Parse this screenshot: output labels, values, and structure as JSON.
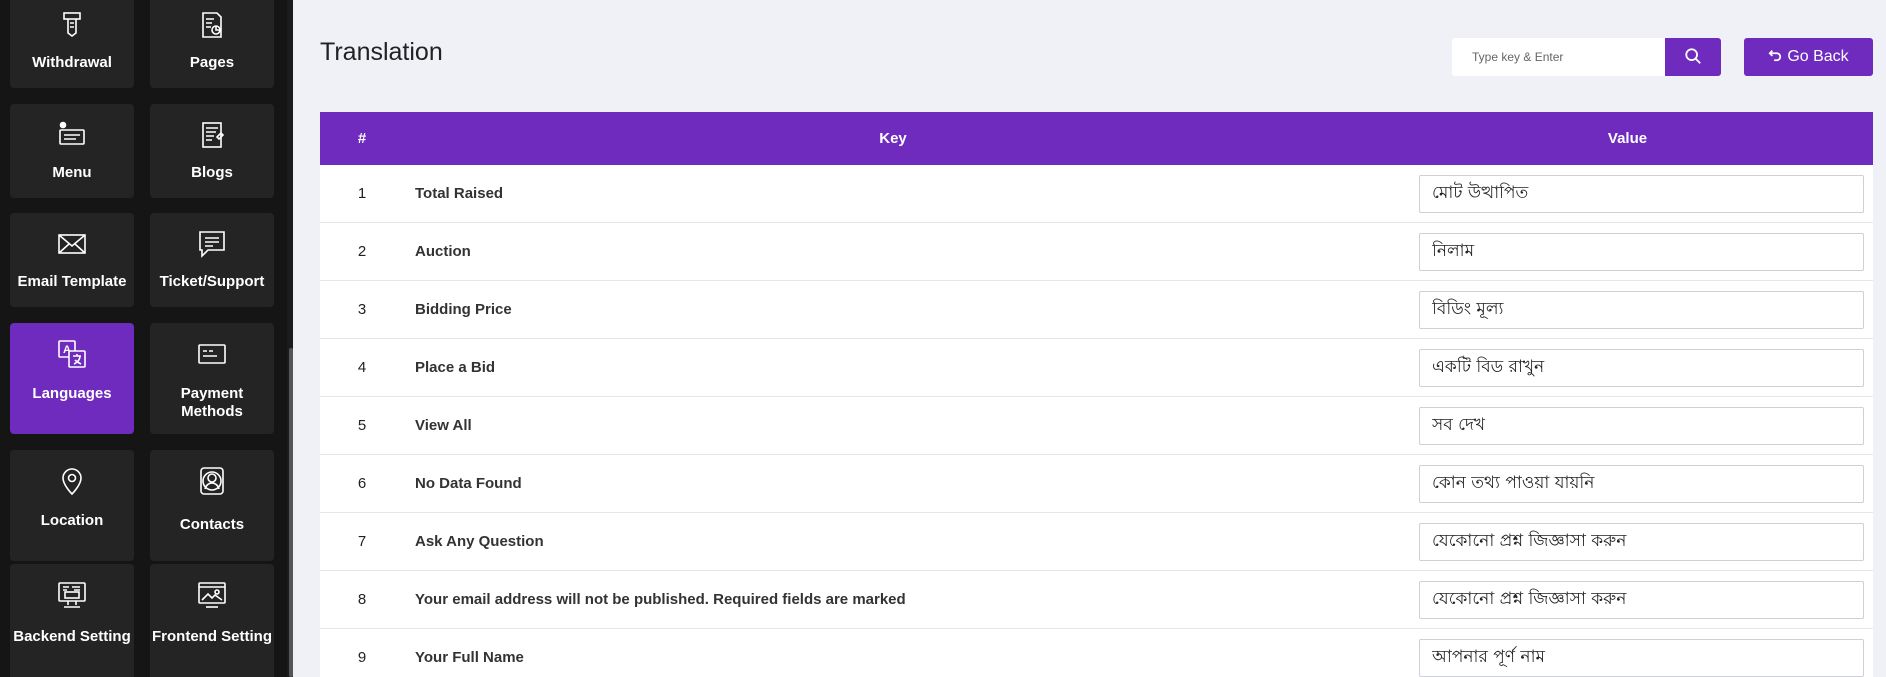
{
  "sidebar": {
    "items": [
      {
        "label": "Withdrawal",
        "icon": "withdrawal-icon"
      },
      {
        "label": "Pages",
        "icon": "pages-icon"
      },
      {
        "label": "Menu",
        "icon": "menu-icon"
      },
      {
        "label": "Blogs",
        "icon": "blogs-icon"
      },
      {
        "label": "Email Template",
        "icon": "email-icon"
      },
      {
        "label": "Ticket/Support",
        "icon": "ticket-icon"
      },
      {
        "label": "Languages",
        "icon": "languages-icon",
        "active": true
      },
      {
        "label": "Payment Methods",
        "icon": "payment-icon"
      },
      {
        "label": "Location",
        "icon": "location-icon"
      },
      {
        "label": "Contacts",
        "icon": "contacts-icon"
      },
      {
        "label": "Backend Setting",
        "icon": "backend-icon"
      },
      {
        "label": "Frontend Setting",
        "icon": "frontend-icon"
      }
    ]
  },
  "header": {
    "title": "Translation",
    "search_placeholder": "Type key & Enter",
    "go_back_label": "Go Back"
  },
  "table": {
    "columns": [
      "#",
      "Key",
      "Value"
    ],
    "rows": [
      {
        "num": "1",
        "key": "Total Raised",
        "value": "মোট উত্থাপিত"
      },
      {
        "num": "2",
        "key": "Auction",
        "value": "নিলাম"
      },
      {
        "num": "3",
        "key": "Bidding Price",
        "value": "বিডিং মূল্য"
      },
      {
        "num": "4",
        "key": "Place a Bid",
        "value": "একটি বিড রাখুন"
      },
      {
        "num": "5",
        "key": "View All",
        "value": "সব দেখ"
      },
      {
        "num": "6",
        "key": "No Data Found",
        "value": "কোন তথ্য পাওয়া যায়নি"
      },
      {
        "num": "7",
        "key": "Ask Any Question",
        "value": "যেকোনো প্রশ্ন জিজ্ঞাসা করুন"
      },
      {
        "num": "8",
        "key": "Your email address will not be published. Required fields are marked",
        "value": "যেকোনো প্রশ্ন জিজ্ঞাসা করুন"
      },
      {
        "num": "9",
        "key": "Your Full Name",
        "value": "আপনার পূর্ণ নাম"
      }
    ]
  },
  "colors": {
    "accent": "#6e2bbd",
    "sidebar_bg": "#151515",
    "tile_bg": "#242424",
    "page_bg": "#f0f1f7"
  }
}
